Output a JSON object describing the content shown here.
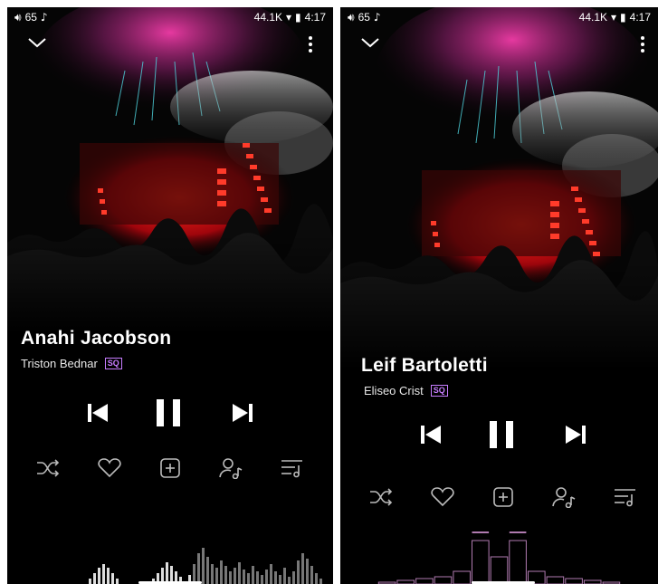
{
  "screens": [
    {
      "status": {
        "volume": "65",
        "speed": "44.1K",
        "time": "4:17"
      },
      "track": {
        "title": "Anahi Jacobson",
        "artist": "Triston Bednar",
        "quality_badge": "SQ"
      },
      "icons": {
        "collapse": "chevron-down-icon",
        "more": "more-vertical-icon",
        "previous": "skip-previous-icon",
        "play_pause": "pause-icon",
        "next": "skip-next-icon",
        "shuffle": "shuffle-icon",
        "favorite": "heart-icon",
        "add": "add-to-playlist-icon",
        "artist": "artist-icon",
        "queue": "queue-icon"
      }
    },
    {
      "status": {
        "volume": "65",
        "speed": "44.1K",
        "time": "4:17"
      },
      "track": {
        "title": "Leif Bartoletti",
        "artist": "Eliseo Crist",
        "quality_badge": "SQ"
      },
      "icons": {
        "collapse": "chevron-down-icon",
        "more": "more-vertical-icon",
        "previous": "skip-previous-icon",
        "play_pause": "pause-icon",
        "next": "skip-next-icon",
        "shuffle": "shuffle-icon",
        "favorite": "heart-icon",
        "add": "add-to-playlist-icon",
        "artist": "artist-icon",
        "queue": "queue-icon"
      }
    }
  ],
  "colors": {
    "accent_badge": "#c77dff",
    "stage_red": "#e0141e",
    "background": "#000000"
  }
}
